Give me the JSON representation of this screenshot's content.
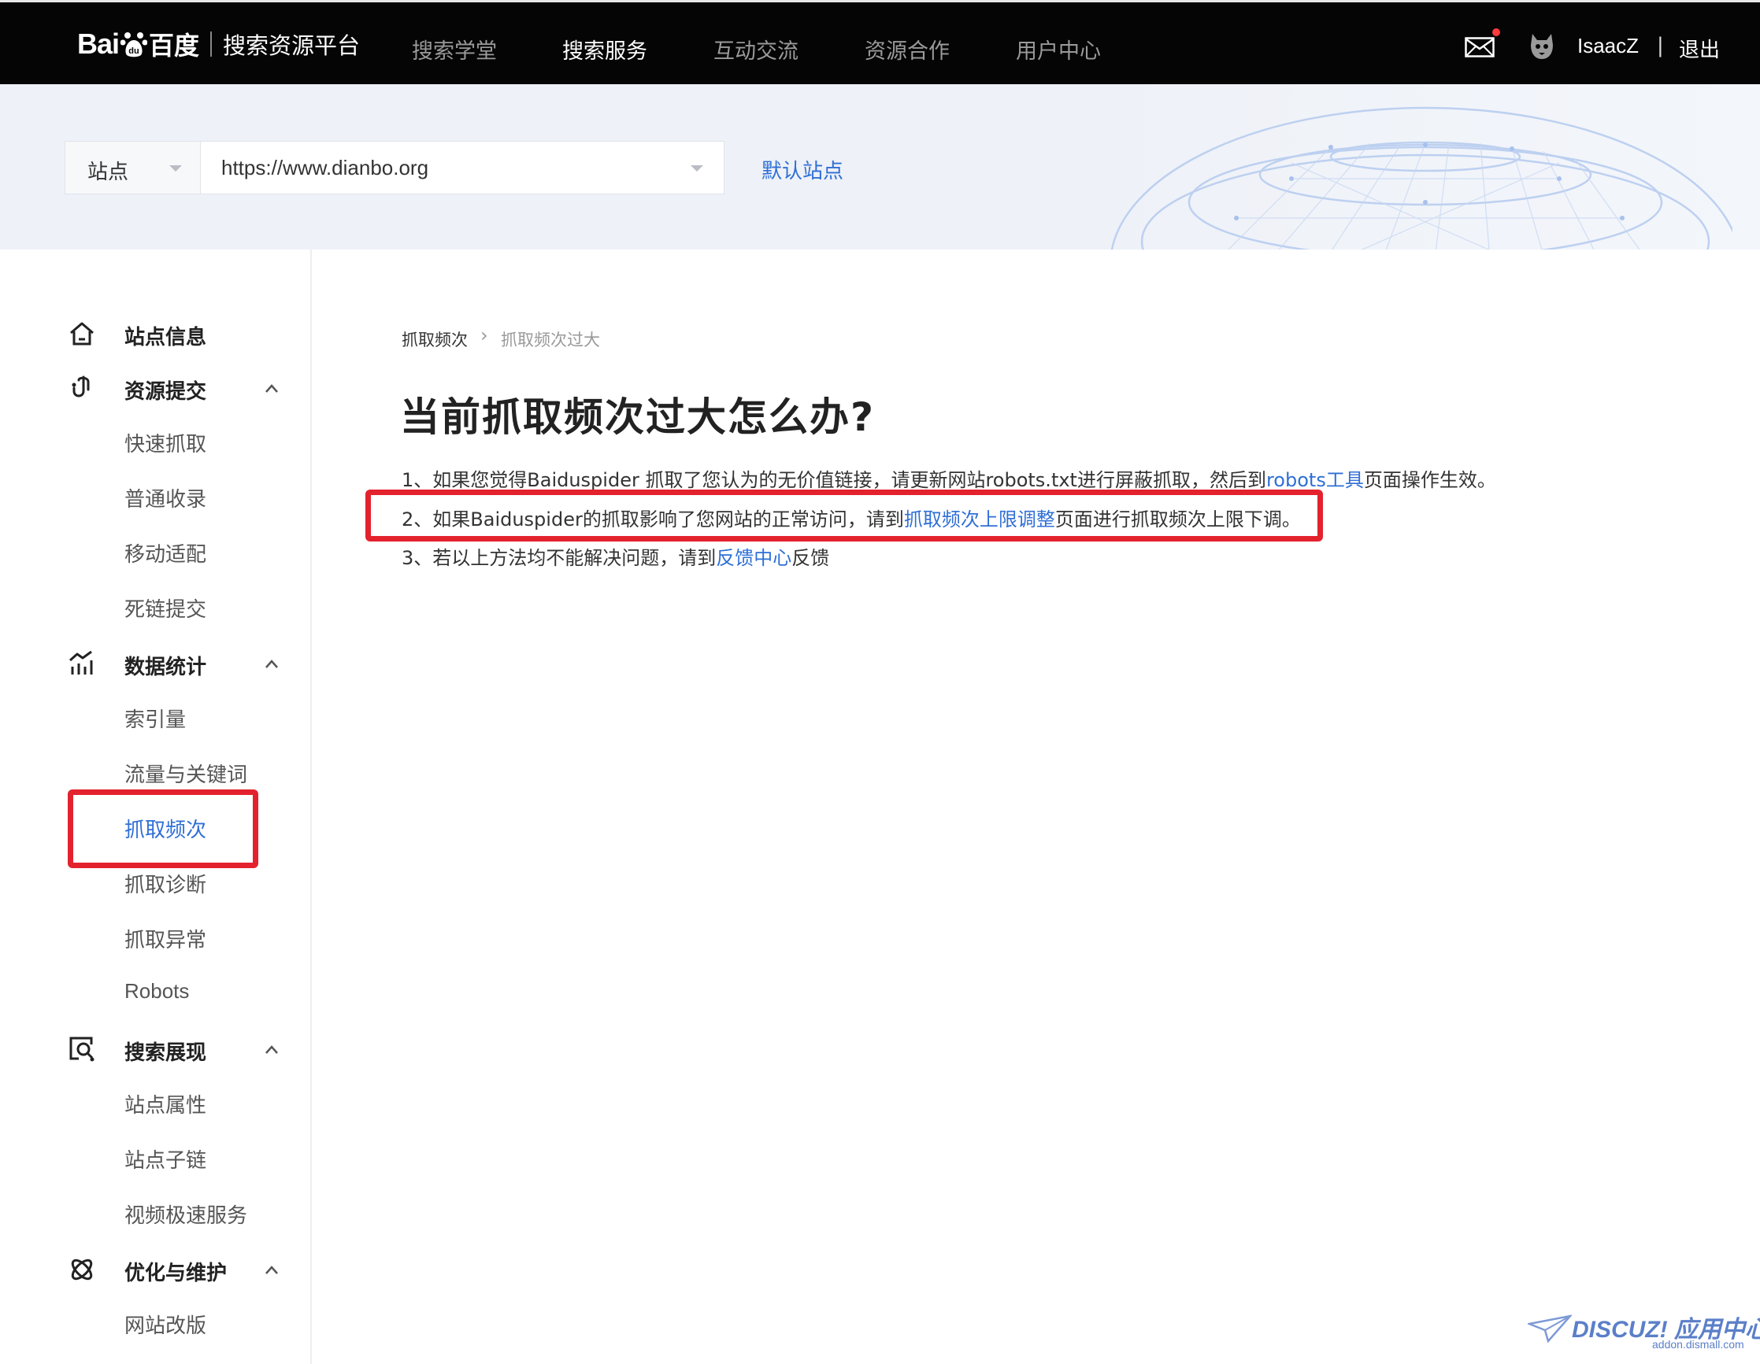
{
  "header": {
    "logo_bai": "Bai",
    "logo_du": "du",
    "logo_bd": "百度",
    "platform": "搜索资源平台",
    "nav": [
      "搜索学堂",
      "搜索服务",
      "互动交流",
      "资源合作",
      "用户中心"
    ],
    "active_nav": "搜索服务",
    "username": "IsaacZ",
    "separator": "|",
    "logout": "退出"
  },
  "sitebar": {
    "select_label": "站点",
    "url": "https://www.dianbo.org",
    "default_site": "默认站点"
  },
  "sidebar": {
    "site_info": "站点信息",
    "resource_submit": {
      "label": "资源提交",
      "items": [
        "快速抓取",
        "普通收录",
        "移动适配",
        "死链提交"
      ]
    },
    "data_stats": {
      "label": "数据统计",
      "items": [
        "索引量",
        "流量与关键词",
        "抓取频次",
        "抓取诊断",
        "抓取异常",
        "Robots"
      ]
    },
    "search_display": {
      "label": "搜索展现",
      "items": [
        "站点属性",
        "站点子链",
        "视频极速服务"
      ]
    },
    "optimize": {
      "label": "优化与维护",
      "items": [
        "网站改版"
      ]
    },
    "active_item": "抓取频次"
  },
  "content": {
    "breadcrumb": [
      "抓取频次",
      "抓取频次过大"
    ],
    "breadcrumb_sep": "›",
    "title": "当前抓取频次过大怎么办?",
    "p1": {
      "before": "1、如果您觉得Baiduspider 抓取了您认为的无价值链接，请更新网站robots.txt进行屏蔽抓取，然后到",
      "link": "robots工具",
      "after": "页面操作生效。"
    },
    "p2": {
      "before": "2、如果Baiduspider的抓取影响了您网站的正常访问，请到",
      "link": "抓取频次上限调整",
      "after": "页面进行抓取频次上限下调。"
    },
    "p3": {
      "before": "3、若以上方法均不能解决问题，请到",
      "link": "反馈中心",
      "after": "反馈"
    }
  },
  "watermark": {
    "main": "DISCUZ! 应用中心",
    "sub": "addon.dismall.com"
  },
  "colors": {
    "nav_bg": "#050505",
    "link": "#2f6fd6",
    "highlight": "#e3222e",
    "sitebar_bg": "#eef1f7"
  }
}
